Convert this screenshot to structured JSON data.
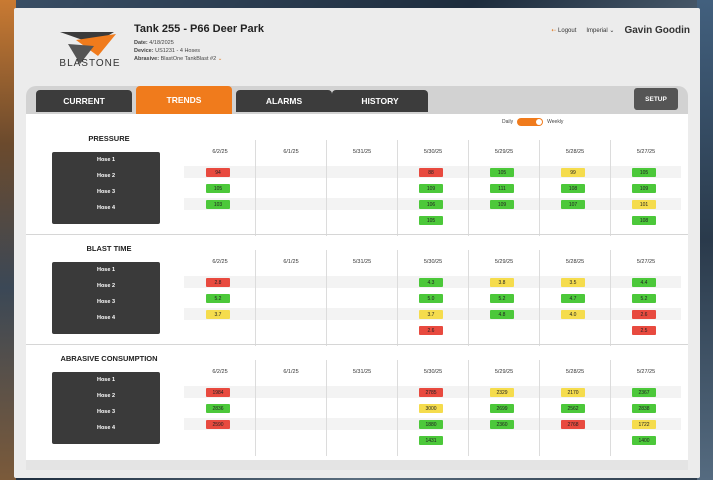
{
  "header": {
    "title": "Tank 255 - P66 Deer Park",
    "date_label": "Date:",
    "date_value": "4/18/2025",
    "device_label": "Device:",
    "device_value": "US1231 - 4 Hoses",
    "abrasive_label": "Abrasive:",
    "abrasive_value": "BlastOne TankBlast #2",
    "logo_text": "BLASTONE",
    "logout": "Logout",
    "units": "Imperial",
    "user": "Gavin Goodin"
  },
  "tabs": [
    {
      "label": "CURRENT"
    },
    {
      "label": "TRENDS"
    },
    {
      "label": "ALARMS"
    },
    {
      "label": "HISTORY"
    }
  ],
  "setup_label": "SETUP",
  "toggle": {
    "left": "Daily",
    "right": "Weekly"
  },
  "dates": [
    "6/2/25",
    "6/1/25",
    "5/31/25",
    "5/30/25",
    "5/29/25",
    "5/28/25",
    "5/27/25"
  ],
  "hoses": [
    "Hose 1",
    "Hose 2",
    "Hose 3",
    "Hose 4"
  ],
  "colors": {
    "red": "#e84a3f",
    "green": "#4cc83a",
    "yellow": "#f5dc4d",
    "accent": "#f07b1c"
  },
  "sections": [
    {
      "title": "PRESSURE",
      "cells": [
        [
          [
            "94",
            "red"
          ],
          [
            "105",
            "green"
          ],
          [
            "103",
            "green"
          ],
          null
        ],
        [
          null,
          null,
          null,
          null
        ],
        [
          null,
          null,
          null,
          null
        ],
        [
          [
            "88",
            "red"
          ],
          [
            "109",
            "green"
          ],
          [
            "106",
            "green"
          ],
          [
            "105",
            "green"
          ]
        ],
        [
          [
            "105",
            "green"
          ],
          [
            "111",
            "green"
          ],
          [
            "109",
            "green"
          ],
          null
        ],
        [
          [
            "99",
            "yellow"
          ],
          [
            "108",
            "green"
          ],
          [
            "107",
            "green"
          ],
          null
        ],
        [
          [
            "105",
            "green"
          ],
          [
            "109",
            "green"
          ],
          [
            "101",
            "yellow"
          ],
          [
            "108",
            "green"
          ]
        ]
      ]
    },
    {
      "title": "BLAST TIME",
      "cells": [
        [
          [
            "2.8",
            "red"
          ],
          [
            "5.2",
            "green"
          ],
          [
            "3.7",
            "yellow"
          ],
          null
        ],
        [
          null,
          null,
          null,
          null
        ],
        [
          null,
          null,
          null,
          null
        ],
        [
          [
            "4.3",
            "green"
          ],
          [
            "5.0",
            "green"
          ],
          [
            "3.7",
            "yellow"
          ],
          [
            "2.6",
            "red"
          ]
        ],
        [
          [
            "3.8",
            "yellow"
          ],
          [
            "5.2",
            "green"
          ],
          [
            "4.8",
            "green"
          ],
          null
        ],
        [
          [
            "3.5",
            "yellow"
          ],
          [
            "4.7",
            "green"
          ],
          [
            "4.0",
            "yellow"
          ],
          null
        ],
        [
          [
            "4.4",
            "green"
          ],
          [
            "5.2",
            "green"
          ],
          [
            "2.6",
            "red"
          ],
          [
            "2.5",
            "red"
          ]
        ]
      ]
    },
    {
      "title": "ABRASIVE CONSUMPTION",
      "cells": [
        [
          [
            "1984",
            "red"
          ],
          [
            "2836",
            "green"
          ],
          [
            "2590",
            "red"
          ],
          null
        ],
        [
          null,
          null,
          null,
          null
        ],
        [
          null,
          null,
          null,
          null
        ],
        [
          [
            "2785",
            "red"
          ],
          [
            "3000",
            "yellow"
          ],
          [
            "1880",
            "green"
          ],
          [
            "1431",
            "green"
          ]
        ],
        [
          [
            "2329",
            "yellow"
          ],
          [
            "2699",
            "green"
          ],
          [
            "2360",
            "green"
          ],
          null
        ],
        [
          [
            "2170",
            "yellow"
          ],
          [
            "2562",
            "green"
          ],
          [
            "2768",
            "red"
          ],
          null
        ],
        [
          [
            "2367",
            "green"
          ],
          [
            "2838",
            "green"
          ],
          [
            "1722",
            "yellow"
          ],
          [
            "1400",
            "green"
          ]
        ]
      ]
    }
  ]
}
